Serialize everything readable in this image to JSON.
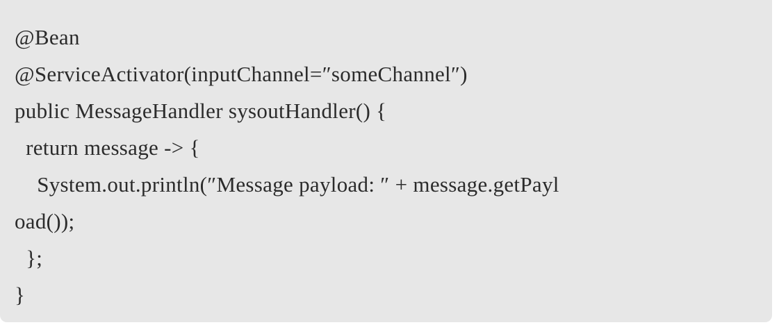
{
  "code_block": {
    "lines": [
      "@Bean",
      "@ServiceActivator(inputChannel=″someChannel″)",
      "public MessageHandler sysoutHandler() {",
      "  return message -> {",
      "    System.out.println(″Message payload: ″ + message.getPayl",
      "oad());",
      "  };",
      "}"
    ]
  }
}
